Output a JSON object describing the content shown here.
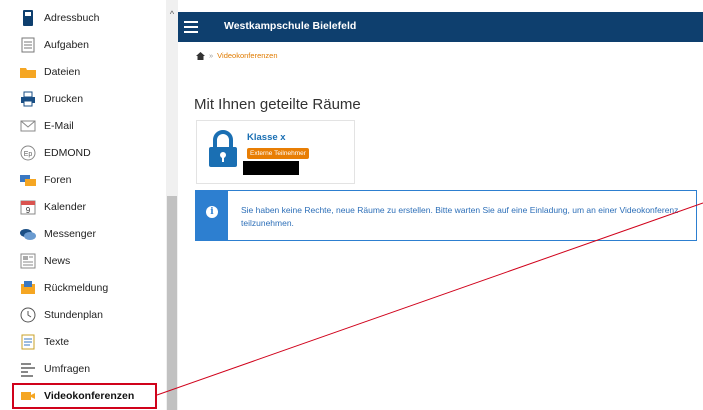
{
  "sidebar": {
    "items": [
      {
        "label": "Adressbuch",
        "icon": "addressbook-icon"
      },
      {
        "label": "Aufgaben",
        "icon": "tasks-icon"
      },
      {
        "label": "Dateien",
        "icon": "folder-icon"
      },
      {
        "label": "Drucken",
        "icon": "printer-icon"
      },
      {
        "label": "E-Mail",
        "icon": "mail-icon"
      },
      {
        "label": "EDMOND",
        "icon": "edmond-icon"
      },
      {
        "label": "Foren",
        "icon": "forum-icon"
      },
      {
        "label": "Kalender",
        "icon": "calendar-icon"
      },
      {
        "label": "Messenger",
        "icon": "messenger-icon"
      },
      {
        "label": "News",
        "icon": "news-icon"
      },
      {
        "label": "Rückmeldung",
        "icon": "feedback-icon"
      },
      {
        "label": "Stundenplan",
        "icon": "clock-icon"
      },
      {
        "label": "Texte",
        "icon": "text-icon"
      },
      {
        "label": "Umfragen",
        "icon": "poll-icon"
      },
      {
        "label": "Videokonferenzen",
        "icon": "video-icon"
      }
    ],
    "calendar_day": "9",
    "edmond_glyph": "Ep"
  },
  "header": {
    "title": "Westkampschule Bielefeld"
  },
  "breadcrumb": {
    "separator": "»",
    "current": "Videokonferenzen"
  },
  "main": {
    "heading": "Mit Ihnen geteilte Räume",
    "room": {
      "name": "Klasse x",
      "badge": "Externe Teilnehmer"
    },
    "alert": {
      "icon_glyph": "i",
      "text": "Sie haben keine Rechte, neue Räume zu erstellen. Bitte warten Sie auf eine Einladung, um an einer Videokonferenz teilzunehmen."
    }
  },
  "colors": {
    "topbar": "#0e3f6e",
    "accent": "#e07b00",
    "badge": "#e87e04",
    "info": "#2d7fd0",
    "highlight": "#d0021b"
  }
}
